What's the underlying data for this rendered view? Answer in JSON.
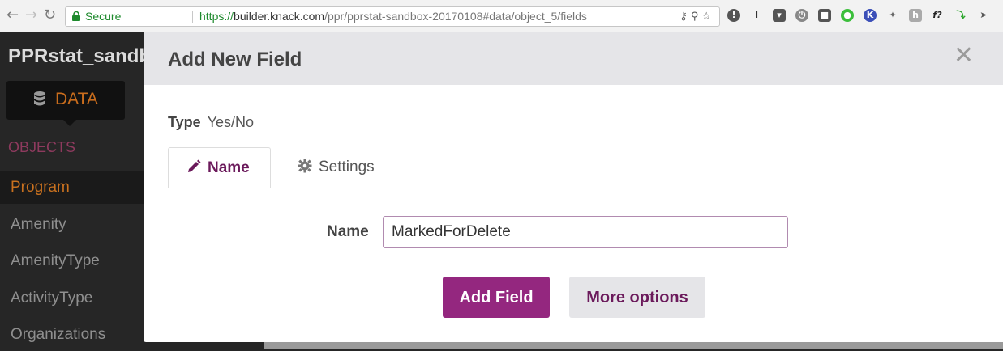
{
  "browser": {
    "secure_label": "Secure",
    "url_scheme": "https://",
    "url_host": "builder.knack.com",
    "url_path": "/ppr/pprstat-sandbox-20170108#data/object_5/fields"
  },
  "app": {
    "title": "PPRstat_sandbox",
    "data_tab_label": "DATA",
    "objects_heading": "OBJECTS",
    "objects": [
      {
        "label": "Program",
        "active": true
      },
      {
        "label": "Amenity",
        "active": false
      },
      {
        "label": "AmenityType",
        "active": false
      },
      {
        "label": "ActivityType",
        "active": false
      },
      {
        "label": "Organizations",
        "active": false
      }
    ]
  },
  "modal": {
    "title": "Add New Field",
    "type_label": "Type",
    "type_value": "Yes/No",
    "tabs": [
      {
        "label": "Name",
        "icon": "pencil-icon",
        "active": true
      },
      {
        "label": "Settings",
        "icon": "gear-icon",
        "active": false
      }
    ],
    "name_label": "Name",
    "name_value": "MarkedForDelete",
    "add_button": "Add Field",
    "more_button": "More options"
  },
  "colors": {
    "accent": "#94277f",
    "accent_dark": "#6b1a5b",
    "secure_green": "#1e8a2d",
    "active_object": "#c9711f"
  }
}
